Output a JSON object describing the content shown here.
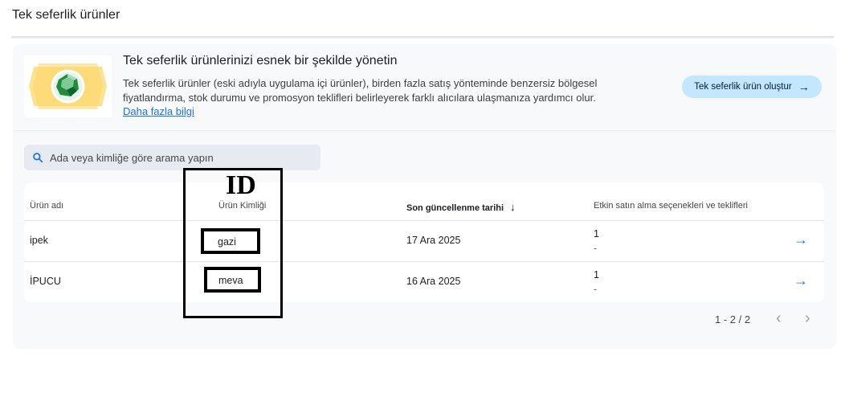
{
  "page": {
    "title": "Tek seferlik ürünler"
  },
  "banner": {
    "title": "Tek seferlik ürünlerinizi esnek bir şekilde yönetin",
    "description": "Tek seferlik ürünler (eski adıyla uygulama içi ürünler), birden fazla satış yönteminde benzersiz bölgesel fiyatlandırma, stok durumu ve promosyon teklifleri belirleyerek farklı alıcılara ulaşmanıza yardımcı olur.",
    "link": "Daha fazla bilgi",
    "create_button": "Tek seferlik ürün oluştur",
    "create_icon": "arrow-right-icon",
    "image_icon": "gem-icon"
  },
  "search": {
    "placeholder": "Ada veya kimliğe göre arama yapın",
    "icon": "search-icon"
  },
  "table": {
    "headers": [
      "Ürün adı",
      "Ürün Kimliği",
      "Son güncellenme tarihi",
      "Etkin satın alma seçenekleri ve teklifleri"
    ],
    "sort_icon": "arrow-down-icon",
    "rows": [
      {
        "name": "ipek",
        "id": "gazi",
        "updated": "17 Ara 2025",
        "options": "1",
        "offers": "-"
      },
      {
        "name": "İPUCU",
        "id": "meva",
        "updated": "16 Ara 2025",
        "options": "1",
        "offers": "-"
      }
    ]
  },
  "pagination": {
    "range": "1 - 2 / 2"
  },
  "annotation": {
    "label": "ID"
  },
  "colors": {
    "accent": "#1a73e8",
    "button_bg": "#c2e7ff",
    "card_bg": "#f8f9fb",
    "search_bg": "#e7ebf1"
  }
}
